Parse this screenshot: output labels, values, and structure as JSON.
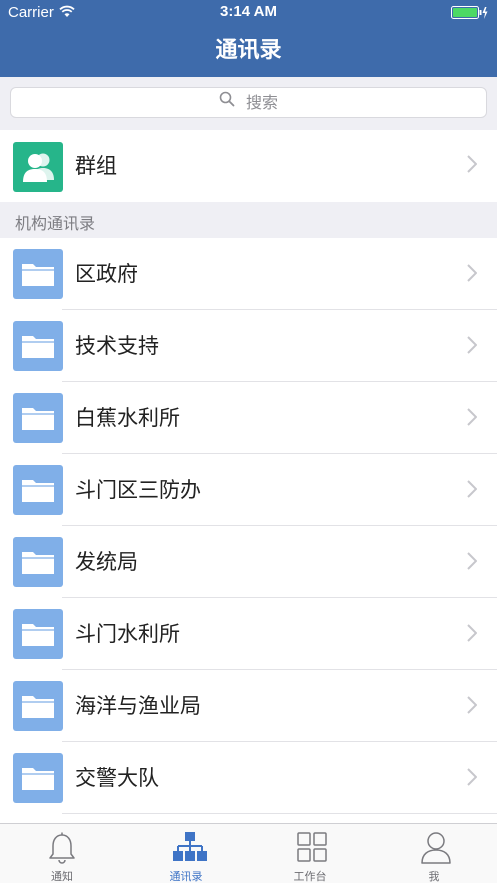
{
  "status_bar": {
    "carrier": "Carrier",
    "time": "3:14 AM"
  },
  "nav": {
    "title": "通讯录"
  },
  "search": {
    "placeholder": "搜索"
  },
  "group": {
    "label": "群组"
  },
  "section": {
    "header": "机构通讯录"
  },
  "orgs": [
    {
      "label": "区政府"
    },
    {
      "label": "技术支持"
    },
    {
      "label": "白蕉水利所"
    },
    {
      "label": "斗门区三防办"
    },
    {
      "label": "发统局"
    },
    {
      "label": "斗门水利所"
    },
    {
      "label": "海洋与渔业局"
    },
    {
      "label": "交警大队"
    }
  ],
  "tabs": [
    {
      "label": "通知",
      "icon": "bell-icon"
    },
    {
      "label": "通讯录",
      "icon": "org-chart-icon",
      "active": true
    },
    {
      "label": "工作台",
      "icon": "grid-icon"
    },
    {
      "label": "我",
      "icon": "person-icon"
    }
  ],
  "colors": {
    "nav_blue": "#3e6bab",
    "group_green": "#26b58a",
    "folder_blue": "#80afe8",
    "active_tab": "#3f74c6"
  }
}
